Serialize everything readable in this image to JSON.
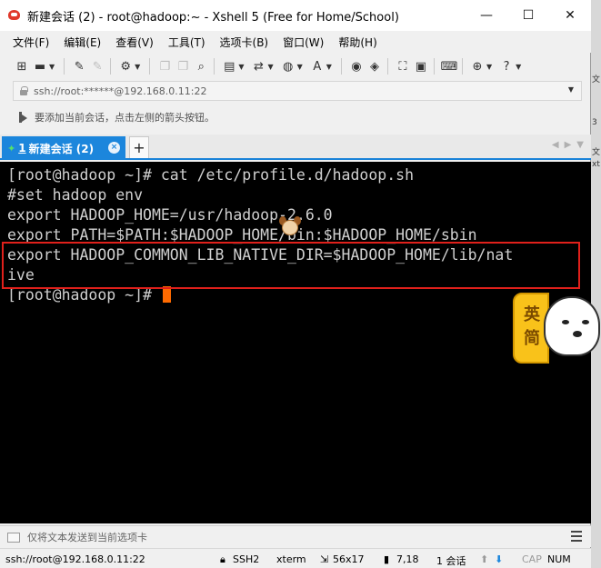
{
  "window": {
    "title": "新建会话 (2) - root@hadoop:~ - Xshell 5 (Free for Home/School)",
    "controls": {
      "minimize": "—",
      "maximize": "☐",
      "close": "✕"
    }
  },
  "menubar": {
    "items": [
      "文件(F)",
      "编辑(E)",
      "查看(V)",
      "工具(T)",
      "选项卡(B)",
      "窗口(W)",
      "帮助(H)"
    ]
  },
  "address": {
    "value": "ssh://root:******@192.168.0.11:22"
  },
  "hint": {
    "text": "要添加当前会话，点击左侧的箭头按钮。"
  },
  "tabs": {
    "active": {
      "number": "1",
      "label": "新建会话 (2)",
      "close": "×"
    },
    "add": "+"
  },
  "terminal": {
    "lines": [
      "[root@hadoop ~]# cat /etc/profile.d/hadoop.sh",
      "#set hadoop env",
      "export HADOOP_HOME=/usr/hadoop-2.6.0",
      "export PATH=$PATH:$HADOOP_HOME/bin:$HADOOP_HOME/sbin",
      "export HADOOP_COMMON_LIB_NATIVE_DIR=$HADOOP_HOME/lib/nat",
      "ive",
      "[root@hadoop ~]# "
    ],
    "colors": {
      "background": "#000000",
      "text": "#d0d0d0",
      "cursor": "#ff6a00",
      "highlight": "#e0201b"
    }
  },
  "widget": {
    "chars": [
      "英",
      "简"
    ]
  },
  "sendbar": {
    "text": "仅将文本发送到当前选项卡"
  },
  "status": {
    "connection": "ssh://root@192.168.0.11:22",
    "protocol": "SSH2",
    "terminal": "xterm",
    "size": "56x17",
    "position": "7,18",
    "sessions": "1 会话",
    "cap": "CAP",
    "num": "NUM"
  },
  "accent": "#1c86dc"
}
